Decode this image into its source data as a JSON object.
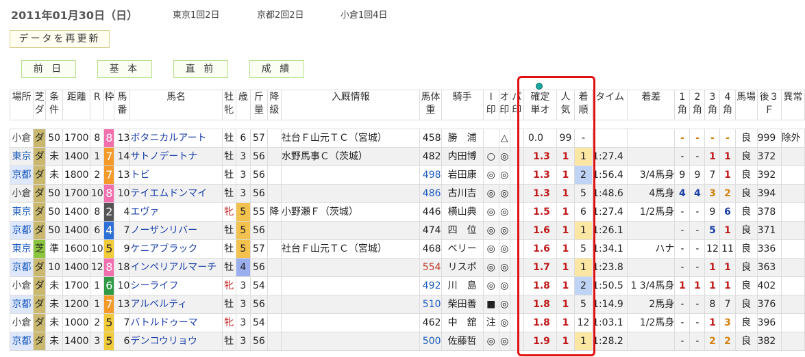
{
  "header": {
    "date": "2011年01月30日（日）",
    "meetings": [
      "東京1回2日",
      "京都2回2日",
      "小倉1回4日"
    ]
  },
  "refresh_label": "データを再更新",
  "nav": [
    "前 日",
    "基 本",
    "直 前",
    "成 績"
  ],
  "columns": [
    "場所",
    "芝ダ",
    "条件",
    "距離",
    "R",
    "枠",
    "馬番",
    "馬名",
    "牡牝",
    "歳",
    "斤量",
    "降級",
    "入厩情報",
    "馬体重",
    "騎手",
    "I印",
    "オ印",
    "パ印",
    "確定単オ",
    "人気",
    "着順",
    "タイム",
    "着差",
    "1角",
    "2角",
    "3角",
    "4角",
    "馬場",
    "後3F",
    "異常"
  ],
  "column_heads": [
    [
      "場所",
      ""
    ],
    [
      "芝",
      "ダ"
    ],
    [
      "条",
      "件"
    ],
    [
      "距離",
      ""
    ],
    [
      "R",
      ""
    ],
    [
      "枠",
      ""
    ],
    [
      "馬",
      "番"
    ],
    [
      "馬名",
      ""
    ],
    [
      "牡",
      "牝"
    ],
    [
      "歳",
      ""
    ],
    [
      "斤",
      "量"
    ],
    [
      "降",
      "級"
    ],
    [
      "入厩情報",
      ""
    ],
    [
      "馬体",
      "重"
    ],
    [
      "騎手",
      ""
    ],
    [
      "I",
      "印"
    ],
    [
      "オ",
      "印"
    ],
    [
      "パ",
      "印"
    ],
    [
      "確定",
      "単オ"
    ],
    [
      "人",
      "気"
    ],
    [
      "着",
      "順"
    ],
    [
      "タイム",
      ""
    ],
    [
      "着差",
      ""
    ],
    [
      "1",
      "角"
    ],
    [
      "2",
      "角"
    ],
    [
      "3",
      "角"
    ],
    [
      "4",
      "角"
    ],
    [
      "馬場",
      ""
    ],
    [
      "後３",
      "Ｆ"
    ],
    [
      "異常",
      ""
    ]
  ],
  "colors": {
    "waku": {
      "1": "#ffffff",
      "2": "#555555",
      "3": "#d93838",
      "4": "#2d6fd6",
      "5": "#f2cb3a",
      "6": "#2f9a45",
      "7": "#f39a2b",
      "8": "#f26fae"
    },
    "accent_red_box": "#e01010",
    "surface_dirt": "#c9b86e",
    "surface_turf": "#8cc63f"
  },
  "rows": [
    {
      "track": "小倉",
      "surface": "ダ",
      "cls": "50",
      "dist": "1700",
      "race": "8",
      "waku": "8",
      "num": "13",
      "name": "ボタニカルアート",
      "sex": "牡",
      "age": "6",
      "kin": "57",
      "kokyu": "",
      "stable": "社台Ｆ山元ＴＣ（宮城）",
      "weight": "458",
      "wcolor": "",
      "jockey": "勝　浦",
      "i": "",
      "o": "△",
      "p": "",
      "odds": "0.0",
      "pop": "99",
      "rank": "-",
      "time": "",
      "margin": "",
      "c1": "-",
      "c2": "-",
      "c3": "-",
      "c4": "-",
      "going": "良",
      "f3": "999",
      "abn": "除外"
    },
    {
      "track": "東京",
      "surface": "ダ",
      "cls": "未",
      "dist": "1400",
      "race": "1",
      "waku": "7",
      "num": "14",
      "name": "サトノデートナ",
      "sex": "牡",
      "age": "3",
      "kin": "56",
      "kokyu": "",
      "stable": "水野馬事Ｃ（茨城）",
      "weight": "482",
      "wcolor": "",
      "jockey": "内田博",
      "i": "○",
      "o": "◎",
      "p": "",
      "odds": "1.3",
      "pop": "1",
      "rank": "1",
      "time": "1:27.4",
      "margin": "",
      "c1": "-",
      "c2": "-",
      "c3": "1",
      "c4": "1",
      "going": "良",
      "f3": "372",
      "abn": ""
    },
    {
      "track": "京都",
      "surface": "ダ",
      "cls": "未",
      "dist": "1800",
      "race": "2",
      "waku": "7",
      "num": "13",
      "name": "トビ",
      "sex": "牡",
      "age": "3",
      "kin": "56",
      "kokyu": "",
      "stable": "",
      "weight": "498",
      "wcolor": "blue",
      "jockey": "岩田康",
      "i": "◎",
      "o": "◎",
      "p": "",
      "odds": "1.3",
      "pop": "1",
      "rank": "2",
      "time": "1:56.4",
      "margin": "3/4馬身",
      "c1": "9",
      "c2": "9",
      "c3": "7",
      "c4": "1",
      "going": "良",
      "f3": "392",
      "abn": ""
    },
    {
      "track": "小倉",
      "surface": "ダ",
      "cls": "50",
      "dist": "1700",
      "race": "10",
      "waku": "8",
      "num": "10",
      "name": "テイエムドンマイ",
      "sex": "牡",
      "age": "3",
      "kin": "56",
      "kokyu": "",
      "stable": "",
      "weight": "486",
      "wcolor": "blue",
      "jockey": "古川吉",
      "i": "◎",
      "o": "◎",
      "p": "",
      "odds": "1.3",
      "pop": "1",
      "rank": "5",
      "time": "1:48.6",
      "margin": "4馬身",
      "c1": "4",
      "c2": "4",
      "c3": "3",
      "c4": "2",
      "going": "良",
      "f3": "394",
      "abn": ""
    },
    {
      "track": "東京",
      "surface": "ダ",
      "cls": "50",
      "dist": "1400",
      "race": "8",
      "waku": "2",
      "num": "4",
      "name": "エヴァ",
      "sex": "牝",
      "age": "5",
      "kin": "55",
      "kokyu": "降",
      "stable": "小野瀬Ｆ（茨城）",
      "weight": "446",
      "wcolor": "",
      "jockey": "横山典",
      "i": "◎",
      "o": "◎",
      "p": "",
      "odds": "1.5",
      "pop": "1",
      "rank": "6",
      "time": "1:27.4",
      "margin": "1/2馬身",
      "c1": "-",
      "c2": "-",
      "c3": "9",
      "c4": "6",
      "going": "良",
      "f3": "378",
      "abn": ""
    },
    {
      "track": "京都",
      "surface": "ダ",
      "cls": "50",
      "dist": "1400",
      "race": "6",
      "waku": "4",
      "num": "7",
      "name": "ノーザンリバー",
      "sex": "牡",
      "age": "5",
      "kin": "56",
      "kokyu": "",
      "stable": "",
      "weight": "474",
      "wcolor": "",
      "jockey": "四　位",
      "i": "◎",
      "o": "◎",
      "p": "",
      "odds": "1.6",
      "pop": "1",
      "rank": "1",
      "time": "1:26.1",
      "margin": "",
      "c1": "-",
      "c2": "-",
      "c3": "5",
      "c4": "1",
      "going": "良",
      "f3": "371",
      "abn": ""
    },
    {
      "track": "東京",
      "surface": "芝",
      "cls": "準",
      "dist": "1600",
      "race": "10",
      "waku": "5",
      "num": "9",
      "name": "ケニアブラック",
      "sex": "牡",
      "age": "5",
      "kin": "57",
      "kokyu": "",
      "stable": "社台Ｆ山元ＴＣ（宮城）",
      "weight": "468",
      "wcolor": "",
      "jockey": "ベリー",
      "i": "◎",
      "o": "◎",
      "p": "",
      "odds": "1.6",
      "pop": "1",
      "rank": "5",
      "time": "1:34.1",
      "margin": "ハナ",
      "c1": "-",
      "c2": "-",
      "c3": "12",
      "c4": "11",
      "going": "良",
      "f3": "336",
      "abn": ""
    },
    {
      "track": "京都",
      "surface": "ダ",
      "cls": "10",
      "dist": "1400",
      "race": "12",
      "waku": "8",
      "num": "18",
      "name": "インペリアルマーチ",
      "sex": "牡",
      "age": "4",
      "kin": "56",
      "kokyu": "",
      "stable": "",
      "weight": "554",
      "wcolor": "red",
      "jockey": "リスポ",
      "i": "◎",
      "o": "◎",
      "p": "",
      "odds": "1.7",
      "pop": "1",
      "rank": "1",
      "time": "1:23.8",
      "margin": "",
      "c1": "-",
      "c2": "-",
      "c3": "1",
      "c4": "1",
      "going": "良",
      "f3": "363",
      "abn": ""
    },
    {
      "track": "小倉",
      "surface": "ダ",
      "cls": "未",
      "dist": "1700",
      "race": "1",
      "waku": "6",
      "num": "10",
      "name": "シーライフ",
      "sex": "牝",
      "age": "3",
      "kin": "54",
      "kokyu": "",
      "stable": "",
      "weight": "492",
      "wcolor": "blue",
      "jockey": "川　島",
      "i": "◎",
      "o": "◎",
      "p": "",
      "odds": "1.8",
      "pop": "1",
      "rank": "2",
      "time": "1:50.5",
      "margin": "1 3/4馬身",
      "c1": "1",
      "c2": "1",
      "c3": "1",
      "c4": "1",
      "going": "良",
      "f3": "402",
      "abn": ""
    },
    {
      "track": "京都",
      "surface": "ダ",
      "cls": "未",
      "dist": "1200",
      "race": "1",
      "waku": "7",
      "num": "13",
      "name": "アルベルティ",
      "sex": "牡",
      "age": "3",
      "kin": "56",
      "kokyu": "",
      "stable": "",
      "weight": "510",
      "wcolor": "blue",
      "jockey": "柴田善",
      "i": "■",
      "o": "◎",
      "p": "",
      "odds": "1.8",
      "pop": "1",
      "rank": "5",
      "time": "1:14.9",
      "margin": "2馬身",
      "c1": "-",
      "c2": "-",
      "c3": "8",
      "c4": "7",
      "going": "良",
      "f3": "376",
      "abn": ""
    },
    {
      "track": "小倉",
      "surface": "ダ",
      "cls": "未",
      "dist": "1000",
      "race": "2",
      "waku": "5",
      "num": "7",
      "name": "バトルドゥーマ",
      "sex": "牝",
      "age": "3",
      "kin": "54",
      "kokyu": "",
      "stable": "",
      "weight": "462",
      "wcolor": "",
      "jockey": "中　舘",
      "i": "注",
      "o": "◎",
      "p": "",
      "odds": "1.8",
      "pop": "1",
      "rank": "12",
      "time": "1:03.1",
      "margin": "1/2馬身",
      "c1": "-",
      "c2": "-",
      "c3": "1",
      "c4": "3",
      "going": "良",
      "f3": "396",
      "abn": ""
    },
    {
      "track": "京都",
      "surface": "ダ",
      "cls": "未",
      "dist": "1400",
      "race": "3",
      "waku": "5",
      "num": "6",
      "name": "デンコウリョウ",
      "sex": "牡",
      "age": "3",
      "kin": "56",
      "kokyu": "",
      "stable": "",
      "weight": "500",
      "wcolor": "blue",
      "jockey": "佐藤哲",
      "i": "◎",
      "o": "◎",
      "p": "",
      "odds": "1.9",
      "pop": "1",
      "rank": "1",
      "time": "1:28.2",
      "margin": "",
      "c1": "-",
      "c2": "-",
      "c3": "2",
      "c4": "2",
      "going": "良",
      "f3": "382",
      "abn": ""
    }
  ]
}
